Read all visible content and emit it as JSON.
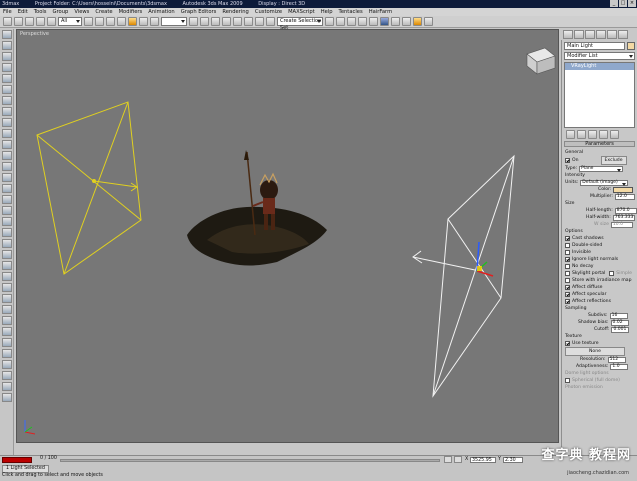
{
  "title": {
    "app": "3dmax",
    "project": "Project Folder: C:\\Users\\hosseini\\Documents\\3dsmax",
    "version": "Autodesk 3ds Max  2009",
    "display": "Display : Direct 3D"
  },
  "menu": [
    "File",
    "Edit",
    "Tools",
    "Group",
    "Views",
    "Create",
    "Modifiers",
    "Animation",
    "Graph Editors",
    "Rendering",
    "Customize",
    "MAXScript",
    "Help",
    "Tentacles",
    "HairFarm"
  ],
  "toolbar": {
    "filter": "All",
    "selection_set": "Create Selection Set"
  },
  "viewport": {
    "label": "Perspective"
  },
  "command_panel": {
    "object_name": "Main Light",
    "modifier_list": "Modifier List",
    "stack_item": "VRayLight",
    "parameters_title": "Parameters",
    "general": {
      "title": "General",
      "on_label": "On",
      "exclude": "Exclude",
      "type_label": "Type:",
      "type_value": "Plane"
    },
    "intensity": {
      "title": "Intensity",
      "units_label": "Units:",
      "units_value": "Default (image)",
      "color_label": "Color:",
      "color_value": "#f3d9a4",
      "multiplier_label": "Multiplier:",
      "multiplier_value": "12.0"
    },
    "size": {
      "title": "Size",
      "half_length_label": "Half-length:",
      "half_length_value": "870.0",
      "half_width_label": "Half-width:",
      "half_width_value": "763.333",
      "w_size_label": "W size",
      "w_size_value": "10.0"
    },
    "options": {
      "title": "Options",
      "items": [
        {
          "label": "Cast shadows",
          "checked": true
        },
        {
          "label": "Double-sided",
          "checked": false
        },
        {
          "label": "Invisible",
          "checked": false
        },
        {
          "label": "Ignore light normals",
          "checked": true
        },
        {
          "label": "No decay",
          "checked": false
        },
        {
          "label": "Skylight portal",
          "checked": false
        },
        {
          "label": "Store with irradiance map",
          "checked": false
        },
        {
          "label": "Affect diffuse",
          "checked": true
        },
        {
          "label": "Affect specular",
          "checked": true
        },
        {
          "label": "Affect reflections",
          "checked": true
        }
      ],
      "simple_label": "Simple"
    },
    "sampling": {
      "title": "Sampling",
      "subdivs_label": "Subdivs:",
      "subdivs_value": "16",
      "shadow_bias_label": "Shadow bias:",
      "shadow_bias_value": "0.02",
      "cutoff_label": "Cutoff:",
      "cutoff_value": "0.001"
    },
    "texture": {
      "title": "Texture",
      "use_texture_label": "Use texture",
      "use_texture_checked": true,
      "map_button": "None",
      "resolution_label": "Resolution:",
      "resolution_value": "512",
      "adaptiveness_label": "Adaptiveness:",
      "adaptiveness_value": "1.0"
    },
    "extra": {
      "dome_label": "Dome light options",
      "spherical_label": "Spherical (full dome)",
      "photon_label": "Photon emission"
    }
  },
  "status": {
    "timeline": "0 / 100",
    "selection": "1 Light Selected",
    "prompt": "Click and drag to select and move objects",
    "coord_x": "3525.95",
    "coord_y": "2.30"
  },
  "watermark": {
    "text": "查字典 教程网",
    "sub": "jiaocheng.chazidian.com"
  }
}
